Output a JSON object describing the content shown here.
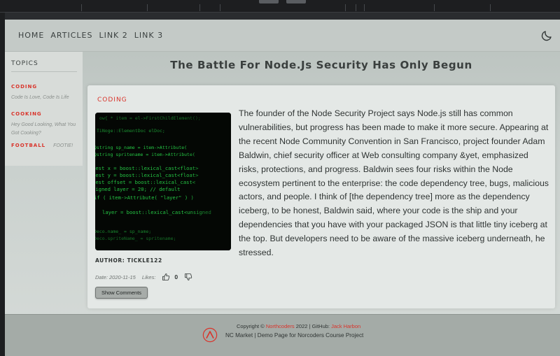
{
  "nav": {
    "links": [
      "HOME",
      "ARTICLES",
      "LINK 2",
      "LINK 3"
    ],
    "theme_icon": "moon-icon"
  },
  "sidebar": {
    "title": "TOPICS",
    "topics": [
      {
        "label": "CODING",
        "description": "Code Is Love, Code Is Life"
      },
      {
        "label": "COOKING",
        "description": "Hey Good Looking, What You Got Cooking?"
      },
      {
        "label": "FOOTBALL",
        "description": "FOOTIE!"
      }
    ]
  },
  "article": {
    "title": "The Battle For Node.Js Security Has Only Begun",
    "topic": "CODING",
    "body": "The founder of the Node Security Project says Node.js still has common vulnerabilities, but progress has been made to make it more secure. Appearing at the recent Node Community Convention in San Francisco, project founder Adam Baldwin, chief security officer at Web consulting company &yet, emphasized risks, protections, and progress. Baldwin sees four risks within the Node ecosystem pertinent to the enterprise: the code dependency tree, bugs, malicious actors, and people. I think of [the dependency tree] more as the dependency iceberg, to be honest, Baldwin said, where your code is the ship and your dependencies that you have with your packaged JSON is that little tiny iceberg at the top. But developers need to be aware of the massive iceberg underneath, he stressed.",
    "author": "AUTHOR: TICKLE122",
    "date": "Date: 2020-11-15",
    "likes_label": "Likes:",
    "votes": "0",
    "show_comments_label": "Show Comments"
  },
  "footer": {
    "copyright_prefix": "Copyright ©",
    "org_link": "Northcoders",
    "copyright_mid": "2022 | GitHub:",
    "github_link": "Jack Harbon",
    "tagline": "NC Market | Demo Page for Norcoders Course Project"
  },
  "colors": {
    "accent": "#d9342b",
    "text": "#2f3433"
  }
}
